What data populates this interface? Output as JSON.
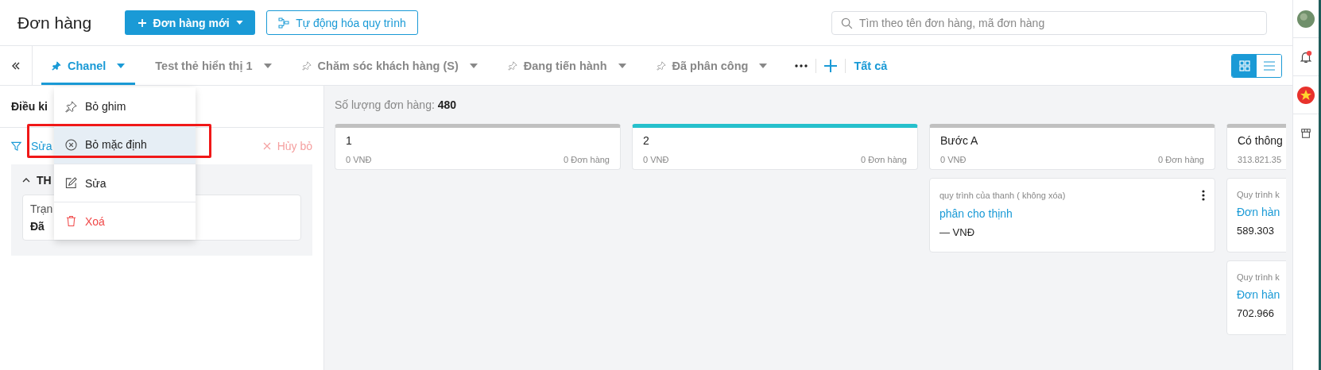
{
  "header": {
    "title": "Đơn hàng",
    "new_order_button": "Đơn hàng mới",
    "automation_button": "Tự động hóa quy trình",
    "search": {
      "placeholder": "Tìm theo tên đơn hàng, mã đơn hàng"
    }
  },
  "tabs": [
    {
      "label": "Chanel",
      "pinned": true,
      "selected": true
    },
    {
      "label": "Test thẻ hiển thị 1",
      "pinned": false,
      "selected": false
    },
    {
      "label": "Chăm sóc khách hàng (S)",
      "pinned": true,
      "selected": false
    },
    {
      "label": "Đang tiến hành",
      "pinned": true,
      "selected": false
    },
    {
      "label": "Đã phân công",
      "pinned": true,
      "selected": false
    }
  ],
  "all_link": "Tất cả",
  "view_toggle": [
    {
      "kind": "grid",
      "selected": true
    },
    {
      "kind": "list",
      "selected": false
    }
  ],
  "context_menu": [
    {
      "kind": "unpin",
      "label": "Bỏ ghim",
      "selected": false
    },
    {
      "kind": "undefault",
      "label": "Bỏ mặc định",
      "selected": true
    },
    {
      "kind": "edit",
      "label": "Sửa",
      "selected": false
    },
    {
      "kind": "delete",
      "label": "Xoá",
      "selected": false
    }
  ],
  "filter_panel": {
    "title": "Điều ki",
    "edit_link": "Sửa",
    "cancel_button": "Hủy bỏ",
    "section": {
      "title": "TH",
      "expanded": true,
      "lines": [
        "Trạn",
        "Đã"
      ]
    }
  },
  "board": {
    "count_label": "Số lượng đơn hàng:",
    "count": "480",
    "columns": [
      {
        "title": "1",
        "color": "#c0c0c0",
        "amount": "0 VNĐ",
        "count": "0 Đơn hàng"
      },
      {
        "title": "2",
        "color": "#26c0cc",
        "amount": "0 VNĐ",
        "count": "0 Đơn hàng"
      },
      {
        "title": "Bước A",
        "color": "#c0c0c0",
        "amount": "0 VNĐ",
        "count": "0 Đơn hàng",
        "cards": [
          {
            "process": "quy trình của thanh ( không xóa)",
            "title": "phân cho thịnh",
            "amount": "— VNĐ",
            "more_menu": true
          }
        ]
      },
      {
        "title": "Có thông",
        "color": "#c0c0c0",
        "amount": "313.821.35",
        "cards": [
          {
            "process": "Quy trình k",
            "title": "Đơn hàn",
            "amount": "589.303",
            "more_menu": false
          },
          {
            "process": "Quy trình k",
            "title": "Đơn hàn",
            "amount": "702.966",
            "more_menu": false
          }
        ]
      }
    ]
  }
}
